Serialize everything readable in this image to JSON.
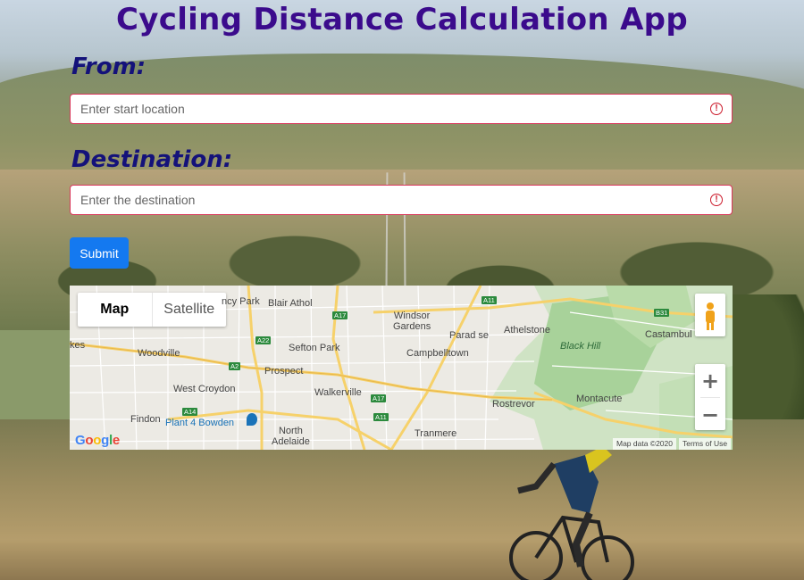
{
  "page": {
    "title": "Cycling Distance Calculation App"
  },
  "form": {
    "from_label": "From:",
    "from_placeholder": "Enter start location",
    "destination_label": "Destination:",
    "destination_placeholder": "Enter the destination",
    "submit_label": "Submit",
    "error_icon_name": "error-icon"
  },
  "map": {
    "type_options": [
      "Map",
      "Satellite"
    ],
    "selected_type": "Map",
    "zoom_in": "+",
    "zoom_out": "−",
    "logo": "Google",
    "map_data": "Map data ©2020",
    "terms": "Terms of Use",
    "places": {
      "cy_park": "ncy Park",
      "blair_athol": "Blair Athol",
      "windsor_gardens": "Windsor\nGardens",
      "paradise": "Parad se",
      "athelstone": "Athelstone",
      "black_hill": "Black Hill",
      "castambul": "Castambul",
      "kes": "kes",
      "woodville": "Woodville",
      "sefton_park": "Sefton Park",
      "campbelltown": "Campbelltown",
      "prospect": "Prospect",
      "west_croydon": "West Croydon",
      "walkerville": "Walkerville",
      "rostrevor": "Rostrevor",
      "montacute": "Montacute",
      "findon": "Findon",
      "plant4": "Plant 4 Bowden",
      "north_adelaide": "North\nAdelaide",
      "tranmere": "Tranmere"
    },
    "shields": {
      "a11_top": "A11",
      "b31": "B31",
      "a17_top": "A17",
      "a22": "A22",
      "a2": "A2",
      "a17_mid": "A17",
      "a14": "A14",
      "a11_bot": "A11"
    }
  },
  "colors": {
    "title": "#3b0b8c",
    "label": "#14127a",
    "submit": "#1479f0",
    "error": "#cc1a2b"
  }
}
